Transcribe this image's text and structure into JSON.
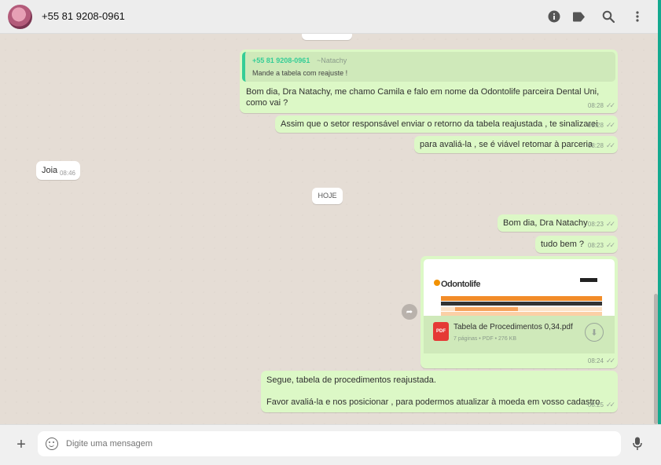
{
  "header": {
    "contact_name": "+55 81 9208-0961",
    "icons": [
      "info-icon",
      "label-icon",
      "search-icon",
      "menu-icon"
    ]
  },
  "messages": {
    "m1": {
      "quote_author": "+55 81 9208-0961",
      "quote_push": "~Natachy",
      "quote_text": "Mande a tabela com reajuste !",
      "text": "Bom dia, Dra Natachy, me chamo Camila  e falo em nome da Odontolife parceira Dental Uni, como vai ?",
      "time": "08:28"
    },
    "m2": {
      "text": "Assim que o setor responsável enviar o retorno da tabela reajustada , te sinalizarei",
      "time": "08:28"
    },
    "m3": {
      "text": "para avaliá-la , se é viável retomar à parceria",
      "time": "08:28"
    },
    "m4": {
      "text": "Joia",
      "time": "08:46"
    },
    "day_divider": "HOJE",
    "m5": {
      "text": "Bom dia, Dra Natachy",
      "time": "08:23"
    },
    "m6": {
      "text": "tudo bem ?",
      "time": "08:23"
    },
    "m7": {
      "doc_name": "Tabela de Procedimentos 0,34.pdf",
      "doc_info": "7 páginas • PDF • 276 KB",
      "file_type": "PDF",
      "time": "08:24",
      "preview_brand": "Odontolife"
    },
    "m8": {
      "line1": "Segue, tabela de procedimentos reajustada.",
      "line2": "Favor avaliá-la e nos posicionar , para podermos atualizar à moeda em vosso cadastro",
      "time": "08:25"
    }
  },
  "footer": {
    "placeholder": "Digite uma mensagem"
  },
  "colors": {
    "outgoing": "#dcf8c6",
    "incoming": "#ffffff",
    "accent": "#35cd96",
    "background": "#e5ddd5"
  }
}
